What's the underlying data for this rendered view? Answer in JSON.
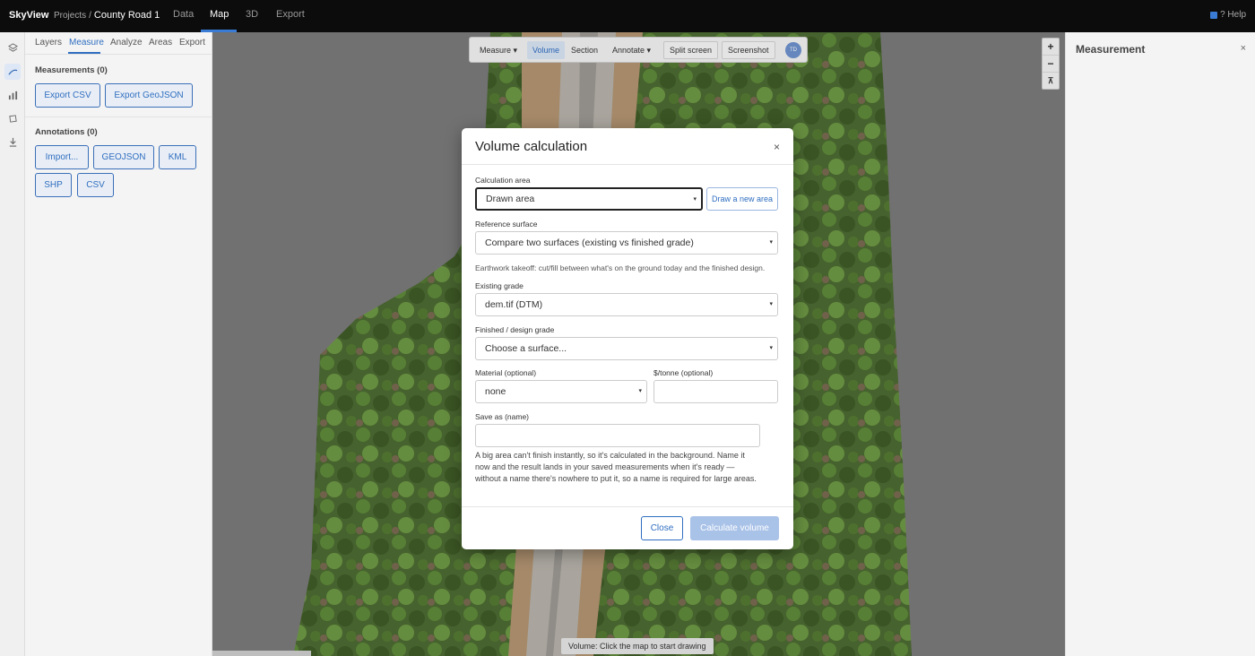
{
  "topbar": {
    "brand": "SkyView",
    "crumb_projects": "Projects",
    "crumb_sep": "/",
    "crumb_project": "County Road 1",
    "tabs": [
      {
        "label": "Data"
      },
      {
        "label": "Map"
      },
      {
        "label": "3D"
      },
      {
        "label": "Export"
      }
    ],
    "active_tab": "Map",
    "help_label": "? Help",
    "help_checked": true
  },
  "rail": {
    "icons": [
      "layers-icon",
      "measure-icon",
      "analyze-icon",
      "areas-icon",
      "export-icon"
    ],
    "active": "measure-icon"
  },
  "panel": {
    "tabs": [
      {
        "label": "Layers"
      },
      {
        "label": "Measure"
      },
      {
        "label": "Analyze"
      },
      {
        "label": "Areas"
      },
      {
        "label": "Export"
      }
    ],
    "active_tab": "Measure",
    "measurements_title": "Measurements (0)",
    "measurement_buttons": [
      "Export CSV",
      "Export GeoJSON"
    ],
    "annotations_title": "Annotations (0)",
    "annotation_buttons": [
      "Import...",
      "GEOJSON",
      "KML",
      "SHP",
      "CSV"
    ]
  },
  "map_toolbar": {
    "items": [
      {
        "label": "Measure ▾"
      },
      {
        "label": "Volume"
      },
      {
        "label": "Section"
      },
      {
        "label": "Annotate ▾"
      },
      {
        "label": "Split screen"
      },
      {
        "label": "Screenshot"
      }
    ],
    "active": "Volume",
    "avatar_initials": "TD"
  },
  "zoom": {
    "in": "+",
    "out": "−",
    "reset": "⊼"
  },
  "status": "Volume: Click the map to start drawing",
  "right_panel": {
    "title": "Measurement",
    "close": "×"
  },
  "modal": {
    "title": "Volume calculation",
    "close": "×",
    "calc_area_label": "Calculation area",
    "calc_area_value": "Drawn area",
    "draw_new_area": "Draw a new area",
    "ref_surface_label": "Reference surface",
    "ref_surface_value": "Compare two surfaces (existing vs finished grade)",
    "ref_help": "Earthwork takeoff: cut/fill between what's on the ground today and the finished design.",
    "existing_label": "Existing grade",
    "existing_value": "dem.tif (DTM)",
    "finished_label": "Finished / design grade",
    "finished_value": "Choose a surface...",
    "material_label": "Material (optional)",
    "material_value": "none",
    "price_label": "$/tonne (optional)",
    "price_value": "",
    "save_label": "Save as (name)",
    "save_value": "",
    "note": "A big area can't finish instantly, so it's calculated in the background. Name it now and the result lands in your saved measurements when it's ready — without a name there's nowhere to put it, so a name is required for large areas.",
    "close_button": "Close",
    "calc_button": "Calculate volume"
  }
}
